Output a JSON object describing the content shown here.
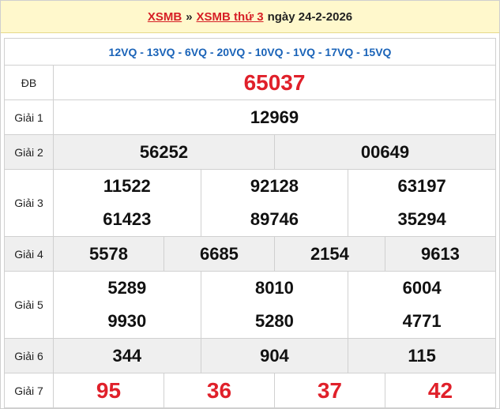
{
  "header": {
    "link1": "XSMB",
    "separator": "»",
    "link2": "XSMB thứ 3",
    "date_text": "ngày 24-2-2026"
  },
  "codes": "12VQ - 13VQ - 6VQ - 20VQ - 10VQ - 1VQ - 17VQ - 15VQ",
  "rows": {
    "db": {
      "label": "ĐB",
      "values": [
        "65037"
      ]
    },
    "g1": {
      "label": "Giải 1",
      "values": [
        "12969"
      ]
    },
    "g2": {
      "label": "Giải 2",
      "values": [
        "56252",
        "00649"
      ]
    },
    "g3": {
      "label": "Giải 3",
      "values": [
        "11522",
        "92128",
        "63197",
        "61423",
        "89746",
        "35294"
      ]
    },
    "g4": {
      "label": "Giải 4",
      "values": [
        "5578",
        "6685",
        "2154",
        "9613"
      ]
    },
    "g5": {
      "label": "Giải 5",
      "values": [
        "5289",
        "8010",
        "6004",
        "9930",
        "5280",
        "4771"
      ]
    },
    "g6": {
      "label": "Giải 6",
      "values": [
        "344",
        "904",
        "115"
      ]
    },
    "g7": {
      "label": "Giải 7",
      "values": [
        "95",
        "36",
        "37",
        "42"
      ]
    }
  },
  "colors": {
    "accent_red": "#e0202a",
    "code_blue": "#1a63b8",
    "header_bg": "#fff8cc"
  }
}
